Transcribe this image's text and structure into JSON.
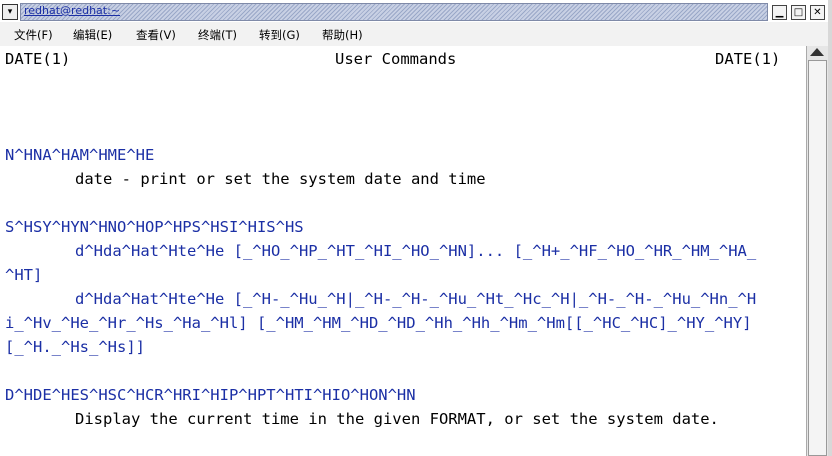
{
  "window": {
    "title": "redhat@redhat:~"
  },
  "menu": [
    {
      "label": "文件(F)"
    },
    {
      "label": "编辑(E)"
    },
    {
      "label": "查看(V)"
    },
    {
      "label": "终端(T)"
    },
    {
      "label": "转到(G)"
    },
    {
      "label": "帮助(H)"
    }
  ],
  "terminal": {
    "lines": [
      "DATE(1)",
      "User Commands",
      "DATE(1)",
      "N^HNA^HAM^HME^HE",
      "date - print or set the system date and time",
      "S^HSY^HYN^HNO^HOP^HPS^HSI^HIS^HS",
      "d^Hda^Hat^Hte^He [_^HO_^HP_^HT_^HI_^HO_^HN]... [_^H+_^HF_^HO_^HR_^HM_^HA_",
      "^HT]",
      "d^Hda^Hat^Hte^He [_^H-_^Hu_^H|_^H-_^H-_^Hu_^Ht_^Hc_^H|_^H-_^H-_^Hu_^Hn_^H",
      "i_^Hv_^He_^Hr_^Hs_^Ha_^Hl] [_^HM_^HM_^HD_^HD_^Hh_^Hh_^Hm_^Hm[[_^HC_^HC]_^HY_^HY]",
      "[_^H._^Hs_^Hs]]",
      "D^HDE^HES^HSC^HCR^HRI^HIP^HPT^HTI^HIO^HON^HN",
      "Display the current time in the given FORMAT, or set the system date."
    ]
  }
}
